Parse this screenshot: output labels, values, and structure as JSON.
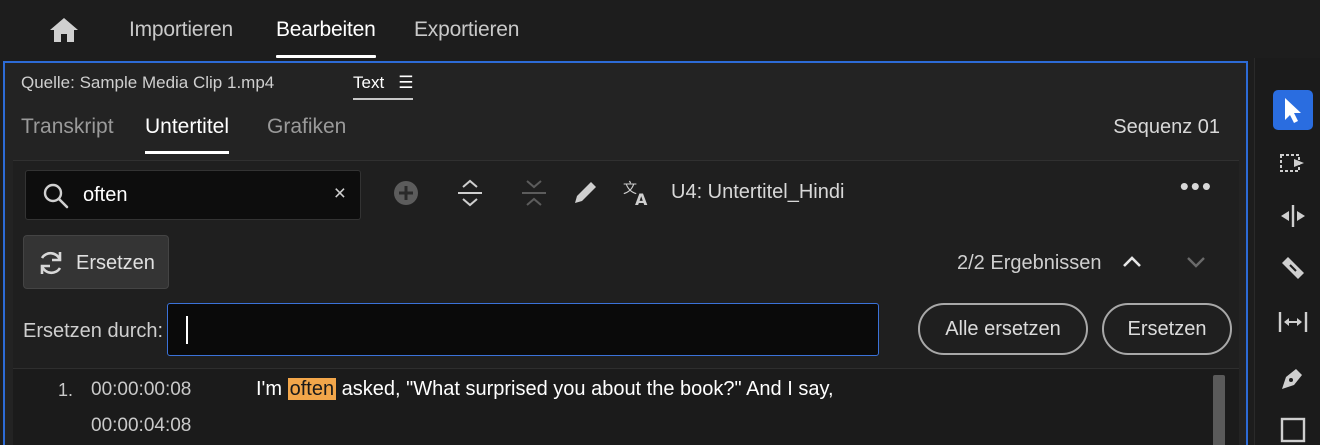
{
  "nav": {
    "home_icon": "home-icon",
    "tabs": [
      {
        "label": "Importieren",
        "active": false
      },
      {
        "label": "Bearbeiten",
        "active": true
      },
      {
        "label": "Exportieren",
        "active": false
      }
    ]
  },
  "panel": {
    "source_label": "Quelle: Sample Media Clip 1.mp4",
    "text_tab_label": "Text",
    "subtabs": [
      {
        "label": "Transkript",
        "active": false
      },
      {
        "label": "Untertitel",
        "active": true
      },
      {
        "label": "Grafiken",
        "active": false
      }
    ],
    "sequence": "Sequenz 01"
  },
  "toolbar": {
    "search_value": "often",
    "clear_glyph": "×",
    "track_label": "U4: Untertitel_Hindi",
    "more_glyph": "•••",
    "icons": [
      "add-caption-icon",
      "split-caption-icon",
      "merge-caption-icon",
      "edit-icon",
      "translate-icon"
    ]
  },
  "replace": {
    "button_label": "Ersetzen",
    "results": "2/2 Ergebnissen",
    "with_label": "Ersetzen durch:",
    "with_value": "",
    "replace_all_label": "Alle ersetzen",
    "replace_label": "Ersetzen"
  },
  "captions": [
    {
      "number": "1.",
      "start": "00:00:00:08",
      "end": "00:00:04:08",
      "text_before": "I'm ",
      "highlight": "often",
      "text_after": " asked, \"What surprised you about the book?\" And I say,"
    }
  ],
  "colors": {
    "accent": "#2d6bd6",
    "highlight": "#f2a64a",
    "panel_bg": "#232323",
    "app_bg": "#1d1d1d"
  },
  "tool_strip": [
    "selection-tool-icon",
    "track-select-icon",
    "ripple-edit-icon",
    "razor-icon",
    "slip-icon",
    "pen-icon",
    "rectangle-icon"
  ]
}
